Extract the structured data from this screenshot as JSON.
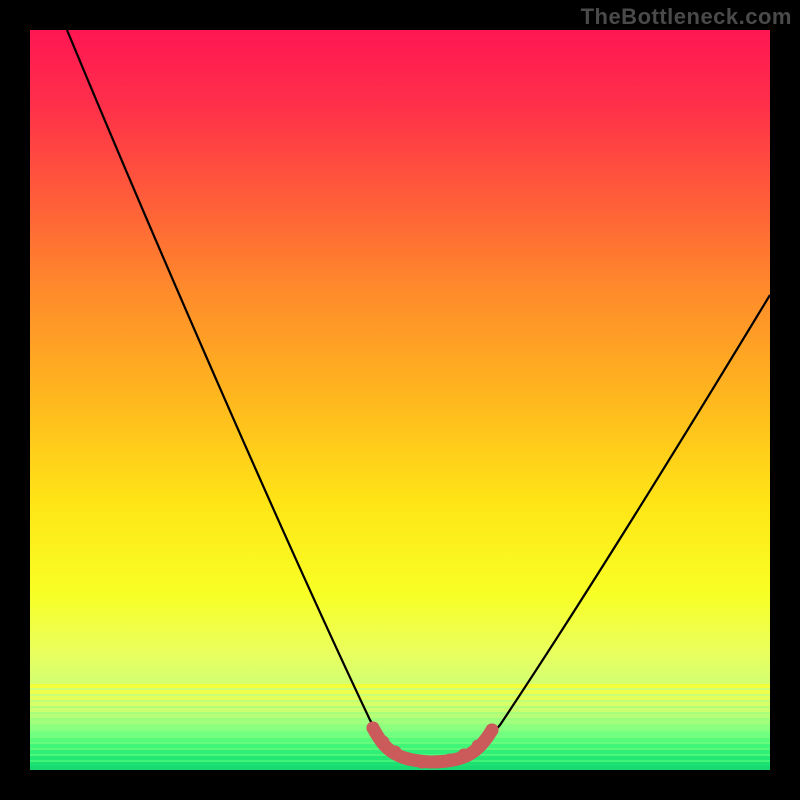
{
  "watermark": "TheBottleneck.com",
  "chart_data": {
    "type": "line",
    "title": "",
    "xlabel": "",
    "ylabel": "",
    "xlim": [
      0,
      100
    ],
    "ylim": [
      0,
      100
    ],
    "series": [
      {
        "name": "curve",
        "x": [
          5,
          10,
          15,
          20,
          25,
          30,
          35,
          40,
          45,
          48,
          50,
          52,
          54,
          56,
          58,
          60,
          62,
          65,
          70,
          75,
          80,
          85,
          90,
          95,
          100
        ],
        "y": [
          100,
          89,
          78,
          68,
          58,
          48,
          38,
          28,
          18,
          10,
          5,
          2,
          1,
          1,
          1,
          1,
          2,
          5,
          12,
          21,
          30,
          39,
          48,
          56,
          63
        ]
      }
    ],
    "highlight": {
      "name": "bottom-segment",
      "x": [
        48,
        50,
        52,
        54,
        56,
        58,
        60,
        62
      ],
      "y": [
        5,
        3,
        2,
        1.5,
        1.5,
        1.5,
        2,
        3
      ],
      "color": "#cb5a5a"
    },
    "gradient_stops": [
      {
        "pos": 0,
        "color": "#ff1653"
      },
      {
        "pos": 10,
        "color": "#ff2f4a"
      },
      {
        "pos": 22,
        "color": "#ff5a3a"
      },
      {
        "pos": 35,
        "color": "#ff8a2b"
      },
      {
        "pos": 50,
        "color": "#ffb81e"
      },
      {
        "pos": 64,
        "color": "#ffe516"
      },
      {
        "pos": 76,
        "color": "#f8ff24"
      },
      {
        "pos": 84,
        "color": "#eaff5e"
      },
      {
        "pos": 90,
        "color": "#caff78"
      },
      {
        "pos": 95,
        "color": "#7eff7e"
      },
      {
        "pos": 100,
        "color": "#2cef76"
      }
    ]
  }
}
